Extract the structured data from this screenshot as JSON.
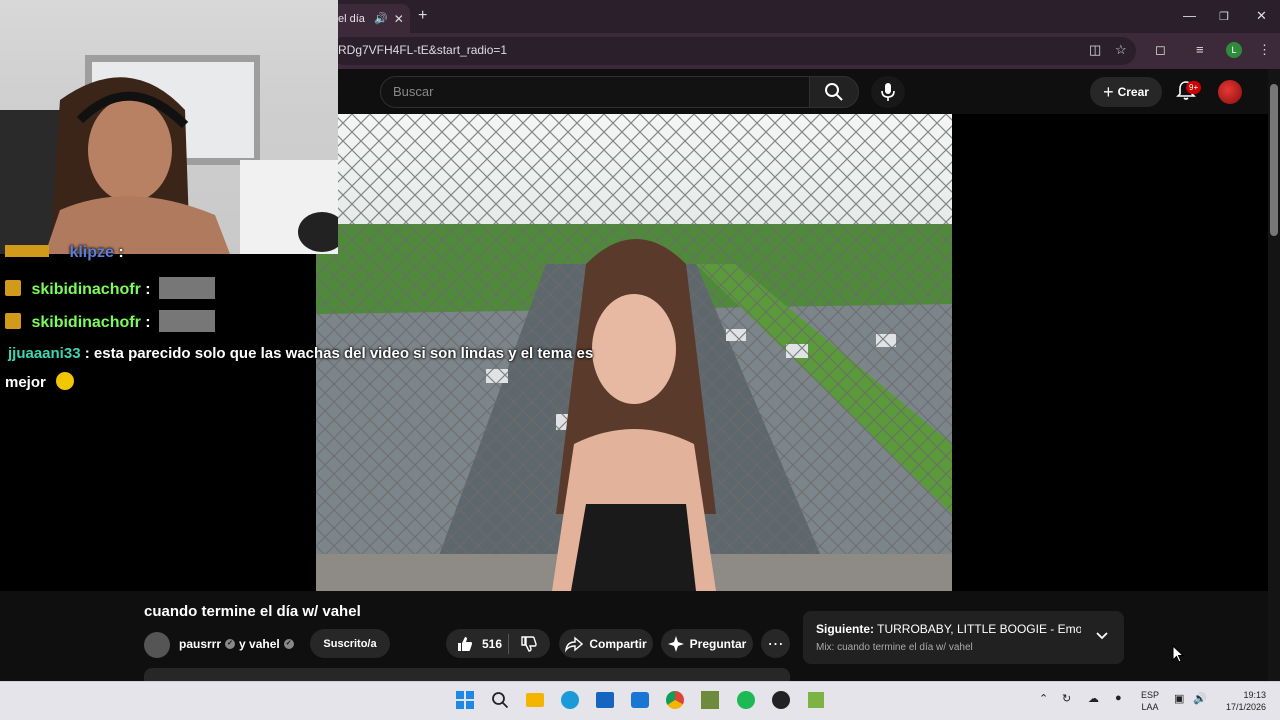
{
  "browser": {
    "tab_title": "el día",
    "url": "RDg7VFH4FL-tE&start_radio=1",
    "profile_initial": "L"
  },
  "youtube": {
    "search_placeholder": "Buscar",
    "create_label": "Crear",
    "notification_count": "9+"
  },
  "chat": {
    "messages": [
      {
        "user": "klipze",
        "text": ":",
        "user_color": "#5b7fd6"
      },
      {
        "user": "skibidinachofr",
        "text": ":",
        "user_color": "#7cfc5a"
      },
      {
        "user": "skibidinachofr",
        "text": ":",
        "user_color": "#7cfc5a"
      },
      {
        "user": "jjuaaani33",
        "text": ": esta parecido solo que las wachas del video si son lindas y el tema es",
        "text_cont": "mejor",
        "user_color": "#3fd5b0"
      }
    ]
  },
  "video": {
    "title": "cuando termine el día w/ vahel",
    "channel": "pausrrr",
    "channel_joiner": "y vahel",
    "subscribe_label": "Suscrito/a",
    "likes": "516",
    "share_label": "Compartir",
    "ask_label": "Preguntar"
  },
  "up_next": {
    "prefix": "Siguiente:",
    "title": "TURROBABY, LITTLE BOOGIE - Emotes (...",
    "mix": "Mix: cuando termine el día w/ vahel"
  },
  "taskbar": {
    "lang_top": "ESP",
    "lang_bottom": "LAA",
    "time": "19:13",
    "date": "17/1/2026"
  },
  "colors": {
    "brand_red": "#cc0000",
    "chrome_frame": "#2b1f2b",
    "yt_bg": "#0f0f0f"
  }
}
